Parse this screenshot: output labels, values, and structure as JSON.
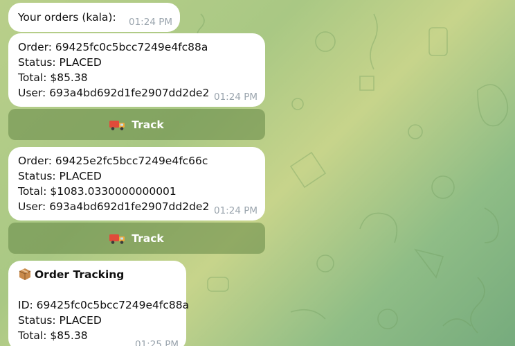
{
  "messages": [
    {
      "lines": [
        "Your orders (kala):"
      ],
      "time": "01:24 PM"
    },
    {
      "lines": [
        "Order: 69425fc0c5bcc7249e4fc88a",
        "Status: PLACED",
        "Total: $85.38",
        "User: 693a4bd692d1fe2907dd2de2"
      ],
      "time": "01:24 PM",
      "button": "Track"
    },
    {
      "lines": [
        "Order: 69425e2fc5bcc7249e4fc66c",
        "Status: PLACED",
        "Total: $1083.0330000000001",
        "User: 693a4bd692d1fe2907dd2de2"
      ],
      "time": "01:24 PM",
      "button": "Track"
    },
    {
      "title": "Order Tracking",
      "lines": [
        "ID: 69425fc0c5bcc7249e4fc88a",
        "Status: PLACED",
        "Total: $85.38"
      ],
      "time": "01:25 PM"
    }
  ],
  "icons": {
    "track_button": "truck-icon",
    "tracking_title": "package-icon"
  },
  "colors": {
    "bubble": "#ffffff",
    "timestamp": "#9aa4ad",
    "button_bg": "rgba(100,135,70,0.55)"
  }
}
